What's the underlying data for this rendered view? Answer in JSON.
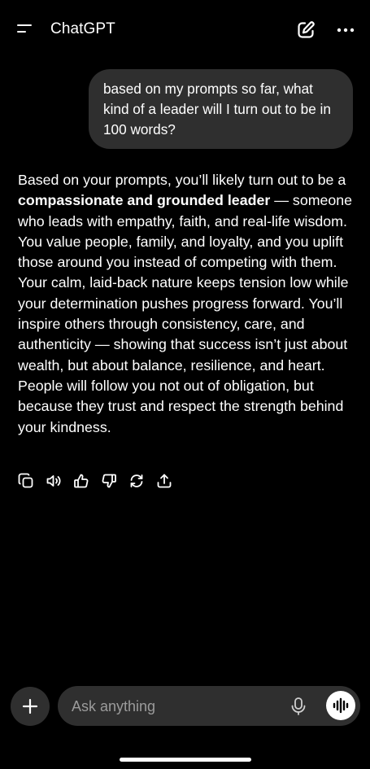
{
  "header": {
    "title": "ChatGPT",
    "menu_icon": "hamburger-icon",
    "new_chat_icon": "compose-icon",
    "more_icon": "ellipsis-icon"
  },
  "user_message": {
    "text": "based on my prompts so far, what kind of a leader will I turn out to be in 100 words?"
  },
  "assistant_message": {
    "intro": "Based on your prompts, you’ll likely turn out to be a ",
    "bold": "compassionate and grounded leader",
    "body": " — someone who leads with empathy, faith, and real-life wisdom. You value people, family, and loyalty, and you uplift those around you instead of competing with them. Your calm, laid-back nature keeps tension low while your determination pushes progress forward. You’ll inspire others through consistency, care, and authenticity — showing that success isn’t just about wealth, but about balance, resilience, and heart. People will follow you not out of obligation, but because they trust and respect the strength behind your kindness."
  },
  "message_actions": [
    "copy-icon",
    "read-aloud-icon",
    "thumbs-up-icon",
    "thumbs-down-icon",
    "regenerate-icon",
    "share-icon"
  ],
  "composer": {
    "placeholder": "Ask anything",
    "plus_icon": "plus-icon",
    "mic_icon": "microphone-icon",
    "voice_icon": "voice-mode-icon"
  },
  "colors": {
    "background": "#000000",
    "bubble": "#2f2f2f",
    "text": "#ffffff",
    "placeholder": "#9b9b9b"
  }
}
